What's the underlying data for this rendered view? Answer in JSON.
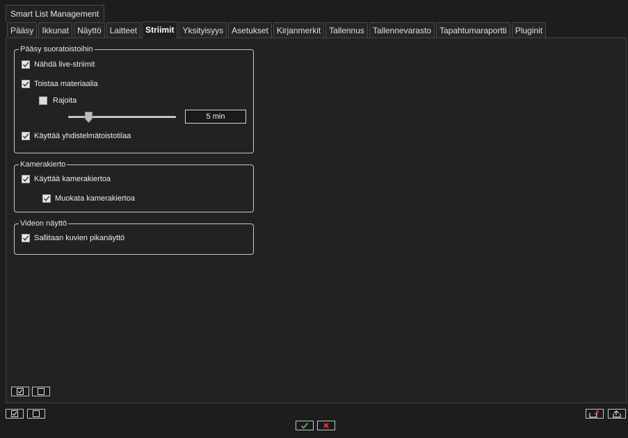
{
  "window_tab": {
    "label": "Smart List Management"
  },
  "tabs": [
    {
      "label": "Pääsy",
      "active": false
    },
    {
      "label": "Ikkunat",
      "active": false
    },
    {
      "label": "Näyttö",
      "active": false
    },
    {
      "label": "Laitteet",
      "active": false
    },
    {
      "label": "Striimit",
      "active": true
    },
    {
      "label": "Yksityisyys",
      "active": false
    },
    {
      "label": "Asetukset",
      "active": false
    },
    {
      "label": "Kirjanmerkit",
      "active": false
    },
    {
      "label": "Tallennus",
      "active": false
    },
    {
      "label": "Tallennevarasto",
      "active": false
    },
    {
      "label": "Tapahtumaraportti",
      "active": false
    },
    {
      "label": "Pluginit",
      "active": false
    }
  ],
  "groups": {
    "live_access": {
      "title": "Pääsy suoratoistoihin",
      "view_live": {
        "label": "Nähdä live-striimit",
        "checked": true
      },
      "playback": {
        "label": "Toistaa materiaalia",
        "checked": true
      },
      "limit": {
        "label": "Rajoita",
        "checked": false
      },
      "limit_slider": {
        "value": 0.17
      },
      "limit_value": "5 min",
      "combined_playback": {
        "label": "Käyttää yhdistelmätoistotilaa",
        "checked": true
      }
    },
    "camera_tour": {
      "title": "Kamerakierto",
      "use_tour": {
        "label": "Käyttää kamerakiertoa",
        "checked": true
      },
      "edit_tour": {
        "label": "Muokata kamerakiertoa",
        "checked": true
      }
    },
    "video_display": {
      "title": "Videon näyttö",
      "quick_view": {
        "label": "Sallitaan kuvien pikanäyttö",
        "checked": true
      }
    }
  },
  "icons": {
    "check_all": "checkbox-checked-icon",
    "uncheck_all": "checkbox-empty-icon",
    "ok": "checkmark-icon",
    "cancel": "close-icon",
    "export": "export-icon",
    "import": "import-icon"
  },
  "colors": {
    "background": "#1d1d1d",
    "ok_green": "#4caf50",
    "cancel_red": "#e53935"
  }
}
